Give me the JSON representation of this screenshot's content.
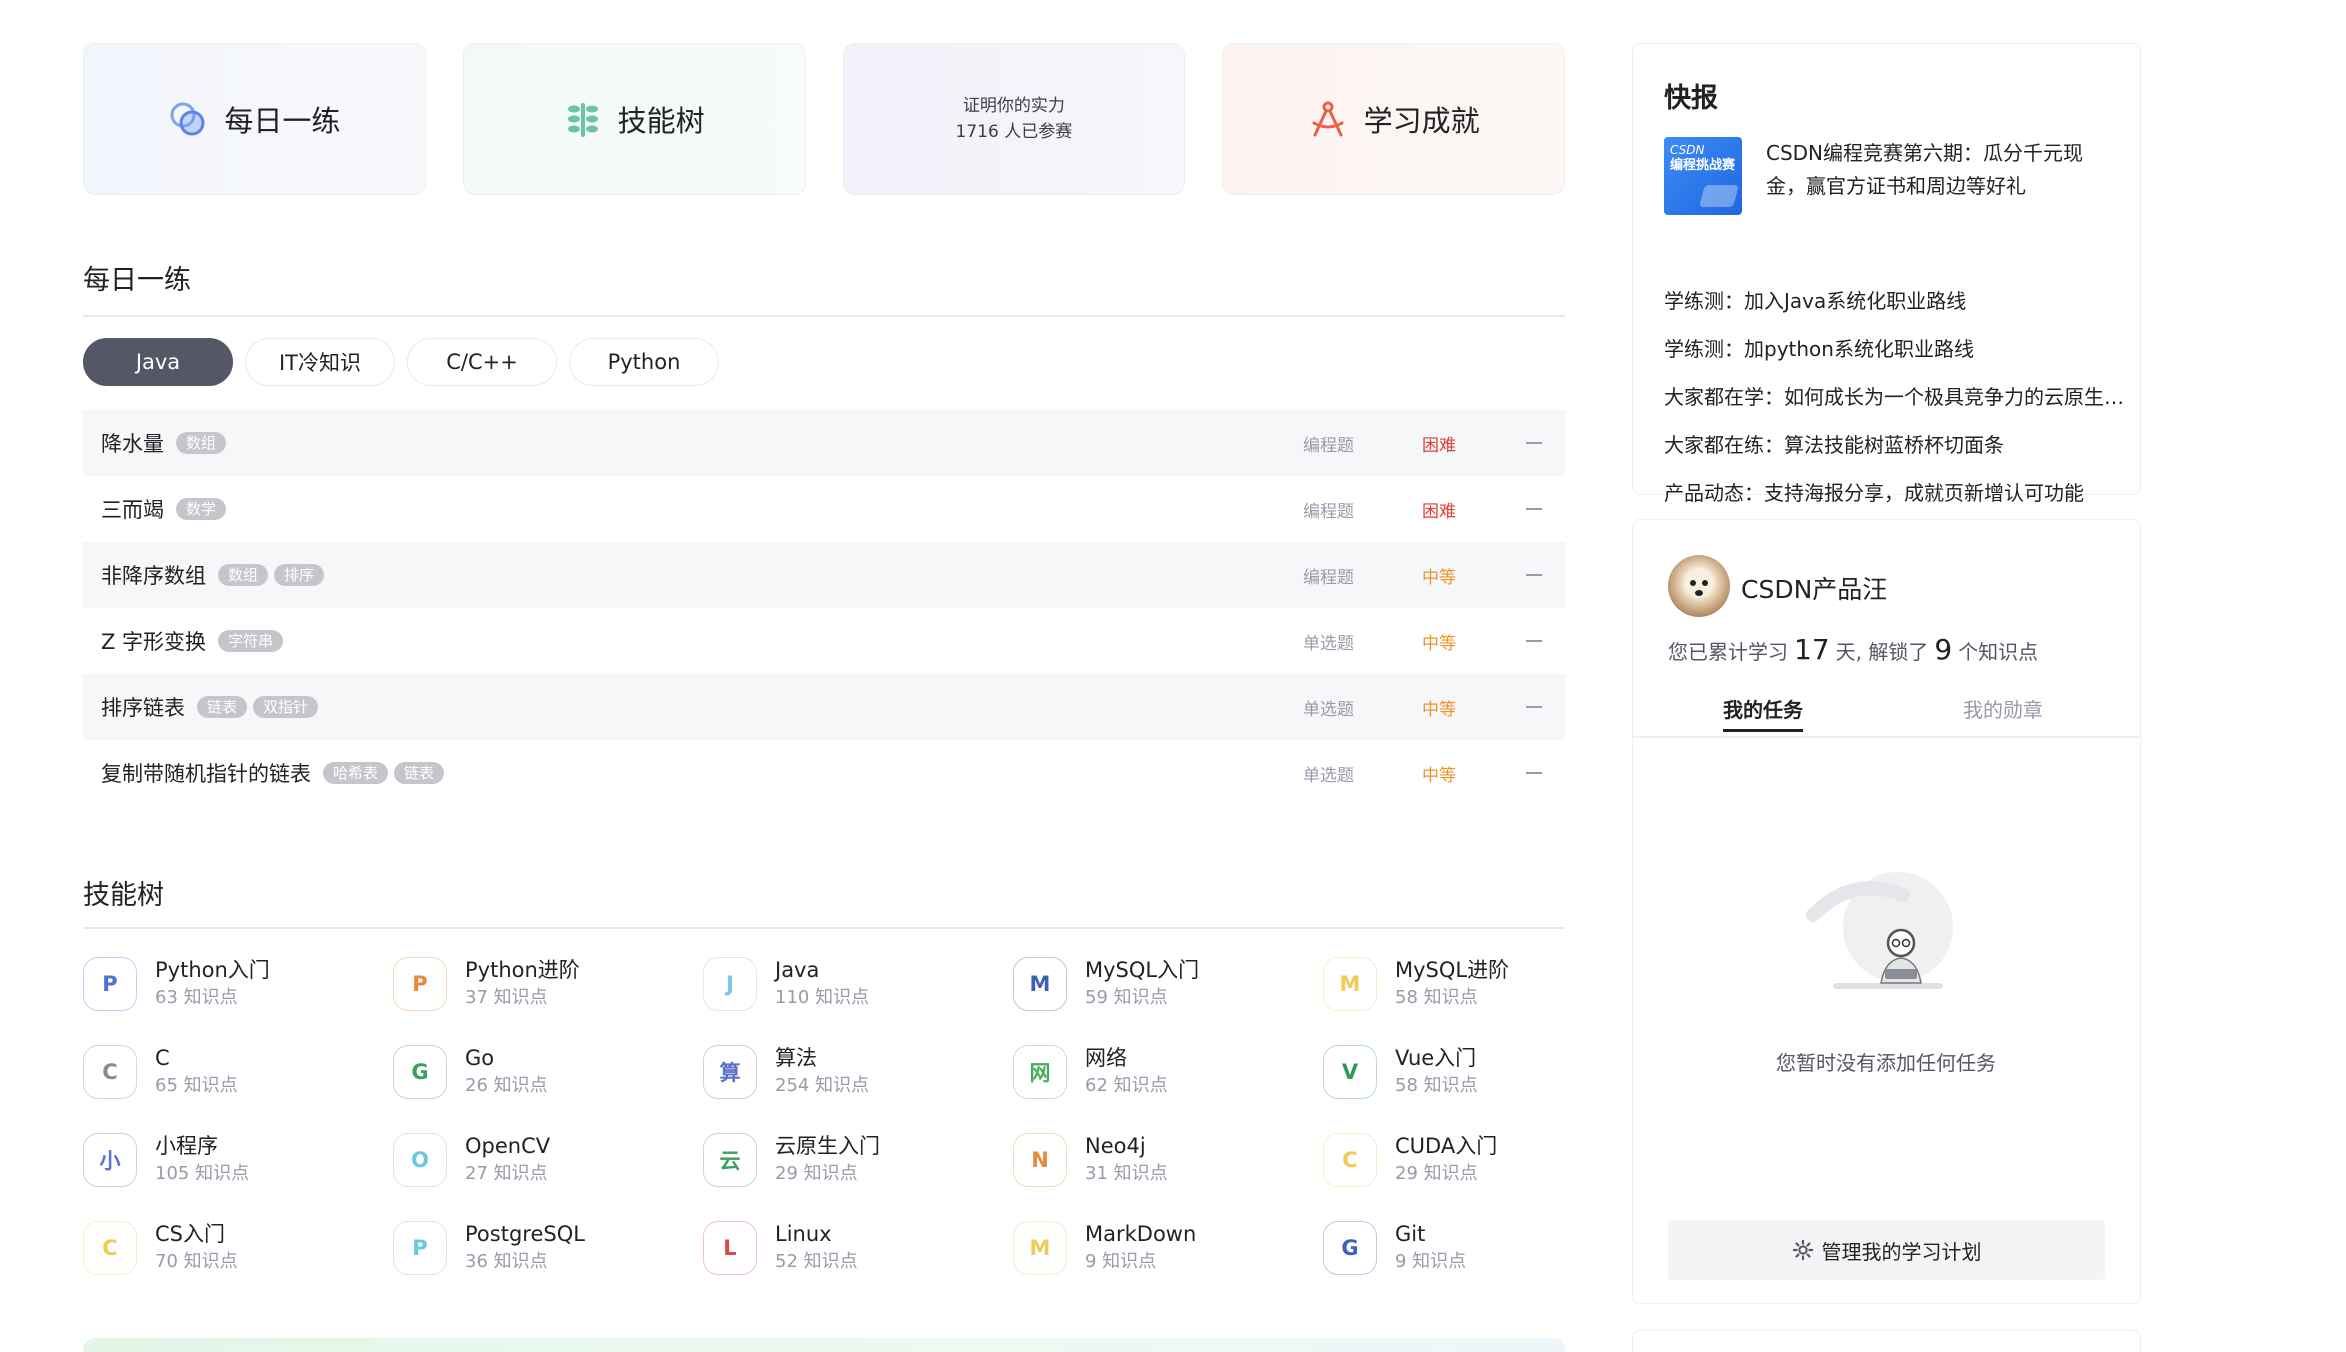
{
  "top_cards": {
    "daily": "每日一练",
    "skill": "技能树",
    "contest_line1": "证明你的实力",
    "contest_line2": "1716 人已参赛",
    "achieve": "学习成就"
  },
  "daily_section": {
    "title": "每日一练",
    "tabs": [
      "Java",
      "IT冷知识",
      "C/C++",
      "Python"
    ],
    "active_tab": "Java",
    "problems": [
      {
        "title": "降水量",
        "tags": [
          "数组"
        ],
        "type": "编程题",
        "difficulty": "困难",
        "level": "hard"
      },
      {
        "title": "三而竭",
        "tags": [
          "数学"
        ],
        "type": "编程题",
        "difficulty": "困难",
        "level": "hard"
      },
      {
        "title": "非降序数组",
        "tags": [
          "数组",
          "排序"
        ],
        "type": "编程题",
        "difficulty": "中等",
        "level": "mid"
      },
      {
        "title": "Z 字形变换",
        "tags": [
          "字符串"
        ],
        "type": "单选题",
        "difficulty": "中等",
        "level": "mid"
      },
      {
        "title": "排序链表",
        "tags": [
          "链表",
          "双指针"
        ],
        "type": "单选题",
        "difficulty": "中等",
        "level": "mid"
      },
      {
        "title": "复制带随机指针的链表",
        "tags": [
          "哈希表",
          "链表"
        ],
        "type": "单选题",
        "difficulty": "中等",
        "level": "mid"
      }
    ]
  },
  "skill_section": {
    "title": "技能树",
    "items": [
      {
        "letter": "P",
        "name": "Python入门",
        "count": "63 知识点",
        "color": "#4a72d9"
      },
      {
        "letter": "P",
        "name": "Python进阶",
        "count": "37 知识点",
        "color": "#e88a3a"
      },
      {
        "letter": "J",
        "name": "Java",
        "count": "110 知识点",
        "color": "#7cc8e8"
      },
      {
        "letter": "M",
        "name": "MySQL入门",
        "count": "59 知识点",
        "color": "#3a62b8"
      },
      {
        "letter": "M",
        "name": "MySQL进阶",
        "count": "58 知识点",
        "color": "#f0cc55"
      },
      {
        "letter": "C",
        "name": "C",
        "count": "65 知识点",
        "color": "#888a94"
      },
      {
        "letter": "G",
        "name": "Go",
        "count": "26 知识点",
        "color": "#3aa05a"
      },
      {
        "letter": "算",
        "name": "算法",
        "count": "254 知识点",
        "color": "#5a72c8"
      },
      {
        "letter": "网",
        "name": "网络",
        "count": "62 知识点",
        "color": "#4aaa62"
      },
      {
        "letter": "V",
        "name": "Vue入门",
        "count": "58 知识点",
        "color": "#2e9a55"
      },
      {
        "letter": "小",
        "name": "小程序",
        "count": "105 知识点",
        "color": "#5a72c8"
      },
      {
        "letter": "O",
        "name": "OpenCV",
        "count": "27 知识点",
        "color": "#6ac8e0"
      },
      {
        "letter": "云",
        "name": "云原生入门",
        "count": "29 知识点",
        "color": "#3aa05a"
      },
      {
        "letter": "N",
        "name": "Neo4j",
        "count": "31 知识点",
        "color": "#e88a3a"
      },
      {
        "letter": "C",
        "name": "CUDA入门",
        "count": "29 知识点",
        "color": "#f0cc55"
      },
      {
        "letter": "C",
        "name": "CS入门",
        "count": "70 知识点",
        "color": "#f0cc55"
      },
      {
        "letter": "P",
        "name": "PostgreSQL",
        "count": "36 知识点",
        "color": "#6ac8e0"
      },
      {
        "letter": "L",
        "name": "Linux",
        "count": "52 知识点",
        "color": "#d94a4a"
      },
      {
        "letter": "M",
        "name": "MarkDown",
        "count": "9 知识点",
        "color": "#f0cc55"
      },
      {
        "letter": "G",
        "name": "Git",
        "count": "9 知识点",
        "color": "#3a62b8"
      }
    ]
  },
  "news": {
    "title": "快报",
    "thumb_line1": "CSDN",
    "thumb_line2": "编程挑战赛",
    "feature": "CSDN编程竞赛第六期：瓜分千元现金，赢官方证书和周边等好礼",
    "items": [
      "学练测：加入Java系统化职业路线",
      "学练测：加python系统化职业路线",
      "大家都在学：如何成长为一个极具竞争力的云原生工程师",
      "大家都在练：算法技能树蓝桥杯切面条",
      "产品动态：支持海报分享，成就页新增认可功能"
    ]
  },
  "profile": {
    "name": "CSDN产品汪",
    "stats_prefix": "您已累计学习",
    "days": "17",
    "stats_mid": "天, 解锁了",
    "points": "9",
    "stats_suffix": "个知识点",
    "tab_tasks": "我的任务",
    "tab_badges": "我的勋章",
    "empty_text": "您暂时没有添加任何任务",
    "manage_button": "管理我的学习计划"
  }
}
